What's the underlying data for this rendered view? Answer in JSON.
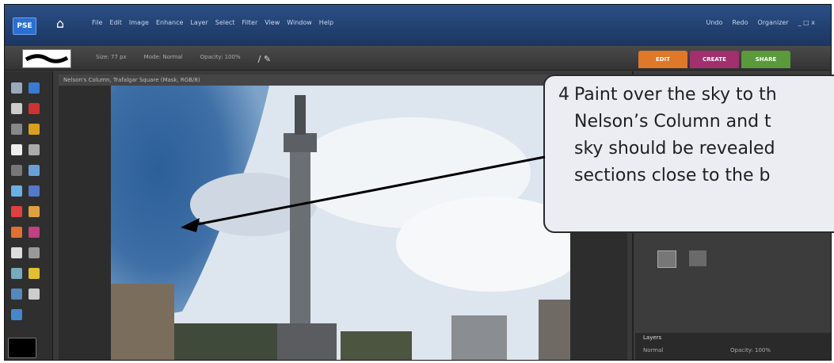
{
  "app": {
    "logo": "PSE",
    "menu": [
      "File",
      "Edit",
      "Image",
      "Enhance",
      "Layer",
      "Select",
      "Filter",
      "View",
      "Window",
      "Help"
    ],
    "top_right": [
      "Undo",
      "Redo",
      "Organizer"
    ]
  },
  "options": [
    "Size: 77 px",
    "Mode: Normal",
    "Opacity: 100%"
  ],
  "tabs": [
    {
      "label": "EDIT",
      "color": "#e0782a"
    },
    {
      "label": "CREATE",
      "color": "#a2306e"
    },
    {
      "label": "SHARE",
      "color": "#5a9a3a"
    }
  ],
  "document": {
    "title": "Nelson's Column, Trafalgar Square (Mask, RGB/8)"
  },
  "panel": {
    "layers_label": "Layers",
    "mode_label": "Normal",
    "opacity_label": "Opacity: 100%"
  },
  "callout": {
    "number": "4",
    "lines": [
      "Paint over the sky to th",
      "Nelson’s Column and t",
      "sky should be revealed",
      "sections close to the b"
    ]
  }
}
